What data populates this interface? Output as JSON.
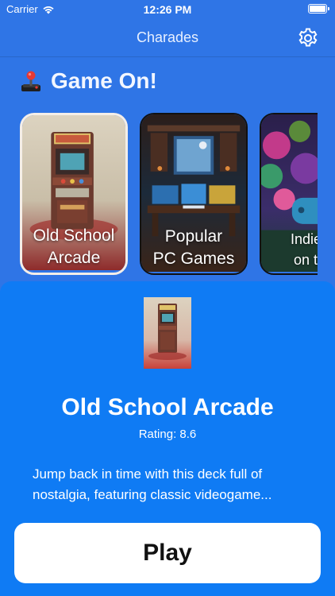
{
  "status_bar": {
    "carrier": "Carrier",
    "time": "12:26 PM"
  },
  "nav": {
    "title": "Charades",
    "settings_icon": "gear-icon"
  },
  "section": {
    "icon": "joystick-icon",
    "title": "Game On!"
  },
  "decks": [
    {
      "label": "Old School\nArcade",
      "selected": true
    },
    {
      "label": "Popular\nPC Games",
      "selected": false
    },
    {
      "label": "Indie G\non the",
      "selected": false
    }
  ],
  "detail": {
    "title": "Old School Arcade",
    "rating": "Rating: 8.6",
    "description": "Jump back in time with this deck full of nostalgia, featuring classic videogame...",
    "play_label": "Play"
  },
  "colors": {
    "background": "#2F75E6",
    "sheet": "#0F7BF4",
    "button": "#FFFFFF"
  }
}
